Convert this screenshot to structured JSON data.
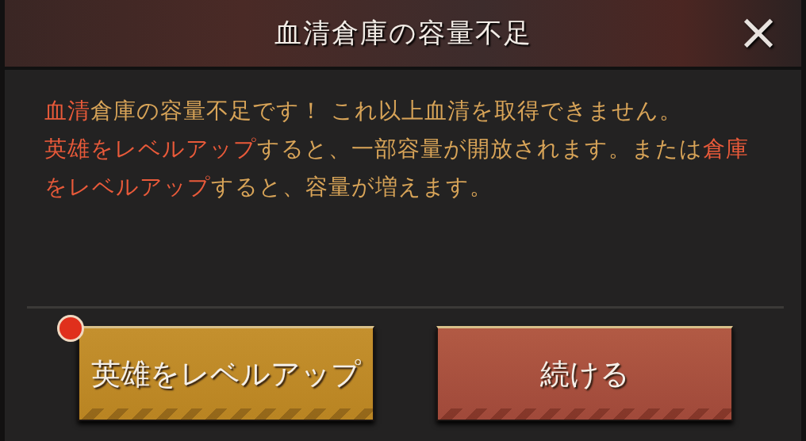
{
  "dialog": {
    "title": "血清倉庫の容量不足",
    "close": "×",
    "paragraphs": [
      [
        {
          "text": "血清",
          "highlight": true
        },
        {
          "text": "倉庫の容量不足です！ これ以上血清を取得できません。",
          "highlight": false
        }
      ],
      [
        {
          "text": "英雄をレベルアップ",
          "highlight": true
        },
        {
          "text": "すると、一部容量が開放されます。または",
          "highlight": false
        },
        {
          "text": "倉庫をレベルアップ",
          "highlight": true
        },
        {
          "text": "すると、容量が増えます。",
          "highlight": false
        }
      ]
    ],
    "buttons": [
      {
        "label": "英雄をレベルアップ",
        "kind": "gold",
        "notification": true
      },
      {
        "label": "続ける",
        "kind": "red",
        "notification": false
      }
    ]
  }
}
